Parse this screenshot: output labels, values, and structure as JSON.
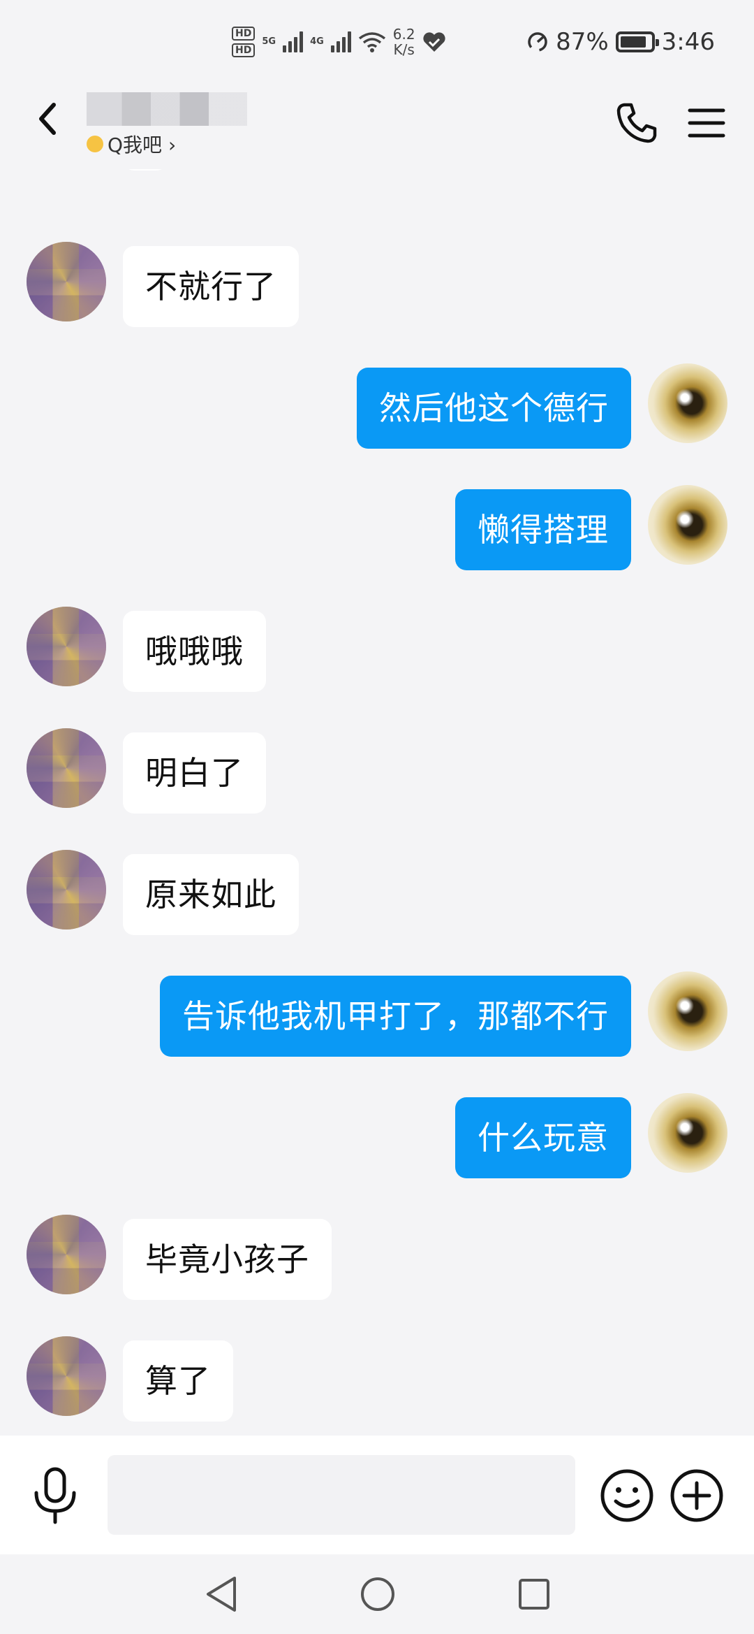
{
  "status_bar": {
    "hd_labels": [
      "HD",
      "HD"
    ],
    "network_labels": [
      "5G",
      "4G"
    ],
    "speed_value": "6.2",
    "speed_unit": "K/s",
    "battery_percent": "87%",
    "time": "3:46",
    "battery_level": 0.87
  },
  "header": {
    "title": "",
    "subtitle": "Q我吧 ›"
  },
  "messages": [
    {
      "sender": "other",
      "text": "不就行了"
    },
    {
      "sender": "self",
      "text": "然后他这个德行"
    },
    {
      "sender": "self",
      "text": "懒得搭理"
    },
    {
      "sender": "other",
      "text": "哦哦哦"
    },
    {
      "sender": "other",
      "text": "明白了"
    },
    {
      "sender": "other",
      "text": "原来如此"
    },
    {
      "sender": "self",
      "text": "告诉他我机甲打了，那都不行"
    },
    {
      "sender": "self",
      "text": "什么玩意"
    },
    {
      "sender": "other",
      "text": "毕竟小孩子"
    },
    {
      "sender": "other",
      "text": "算了"
    }
  ],
  "composer": {
    "input_value": "",
    "input_placeholder": ""
  },
  "icons": {
    "back": "back-arrow-icon",
    "call": "phone-icon",
    "menu": "hamburger-menu-icon",
    "mic": "microphone-icon",
    "emoji": "smiley-icon",
    "plus": "plus-icon",
    "nav_back": "triangle-back-icon",
    "nav_home": "circle-home-icon",
    "nav_recent": "square-recent-icon"
  },
  "colors": {
    "self_bubble": "#0a99f5",
    "other_bubble": "#ffffff",
    "background": "#f4f4f6"
  }
}
